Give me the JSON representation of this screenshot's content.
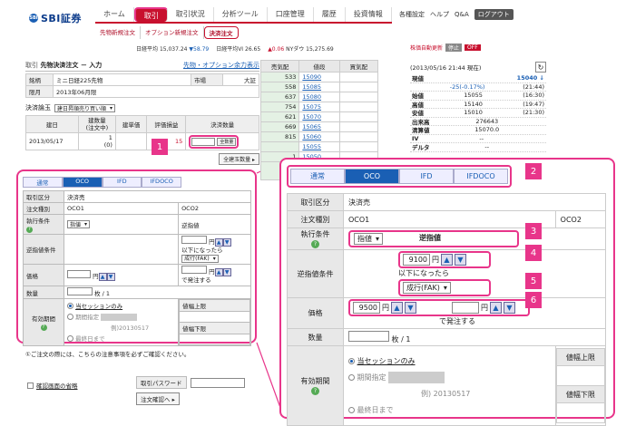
{
  "logo": {
    "mark": "SBI",
    "text": "SBI証券"
  },
  "nav": [
    "ホーム",
    "取引",
    "取引状況",
    "分析ツール",
    "口座管理",
    "履歴",
    "投資情報"
  ],
  "util": [
    "各種設定",
    "ヘルプ",
    "Q&A",
    "ログアウト"
  ],
  "subnav": [
    "先物新規注文",
    "オプション新規注文",
    "決済注文"
  ],
  "ticker": {
    "nikkei_label": "日経平均",
    "nikkei": "15,037.24",
    "nikkei_chg": "▼58.79",
    "nk_label": "日経平均VI",
    "nk": "26.65",
    "ny_chg": "▲0.06",
    "ny_label": "NYダウ",
    "ny": "15,275.69"
  },
  "auto": {
    "label": "株価自動更新",
    "btn": "停止",
    "state": "OFF"
  },
  "left": {
    "title": "先物決済注文 － 入力",
    "title_prefix": "取引",
    "margin_link": "先物・オプション余力表示",
    "product_label": "銘柄",
    "product": "ミニ日経225先物",
    "market_label": "市場",
    "market": "大証",
    "month_label": "限月",
    "month": "2013年06月限",
    "order_label": "決済論玉",
    "order_select": "建日昇順売り買い順",
    "headers": [
      "建日",
      "建数量\n(注文中)",
      "建単価",
      "評価損益",
      "決済数量"
    ],
    "row": {
      "date": "2013/05/17",
      "qty": "1",
      "pending": "(0)",
      "price": "15",
      "btn": "全数量"
    },
    "all_btn": "全建玉数量 ▸",
    "tabs": [
      "通常",
      "OCO",
      "IFD",
      "IFDOCO"
    ],
    "f_kind_label": "取引区分",
    "f_kind": "決済売",
    "f_type_label": "注文種別",
    "f_oco1": "OCO1",
    "f_oco2": "OCO2",
    "f_cond_label": "執行条件",
    "f_cond": "指値",
    "f_cond2": "逆指値",
    "f_stop_label": "逆指値条件",
    "f_stop_text": "以下になったら",
    "f_stop_sel": "成行(FAK)",
    "f_price_label": "価格",
    "f_yen": "円",
    "f_send": "で発注する",
    "f_qty_label": "数量",
    "f_qty_unit": "枚 / 1",
    "f_period_label": "有効期間",
    "f_p1": "当セッションのみ",
    "f_p2": "期間指定",
    "f_p3": "最終日まで",
    "f_date": "例)20130517",
    "f_up": "値幅上限",
    "f_down": "値幅下限",
    "notice": "①ご注文の際には、こちらの注意事項を必ずご確認ください。",
    "confirm": "確認画面の省略",
    "pass_label": "取引パスワード",
    "submit": "注文確認へ ▸"
  },
  "pos": {
    "headers": [
      "売気配",
      "値段",
      "買気配"
    ],
    "prices": [
      "15090",
      "15085",
      "15080",
      "15075",
      "15070",
      "15065",
      "15060",
      "15055",
      "15050"
    ],
    "sells": [
      "533",
      "558",
      "637",
      "754",
      "621",
      "669",
      "815",
      "",
      "1"
    ]
  },
  "quote": {
    "time": "(2013/05/16 21:44 現在)",
    "now_label": "現値",
    "now": "15040 ↓",
    "chg": "-25(-0.17%)",
    "chg_time": "(21:44)",
    "rows": [
      [
        "始値",
        "15055",
        "(16:30)"
      ],
      [
        "高値",
        "15140",
        "(19:47)"
      ],
      [
        "安値",
        "15010",
        "(21:30)"
      ],
      [
        "出来高",
        "276643",
        ""
      ],
      [
        "清算値",
        "15070.0",
        ""
      ],
      [
        "IV",
        "--",
        ""
      ],
      [
        "デルタ",
        "--",
        ""
      ]
    ]
  },
  "zoom": {
    "tabs": [
      "通常",
      "OCO",
      "IFD",
      "IFDOCO"
    ],
    "kind_label": "取引区分",
    "kind": "決済売",
    "type_label": "注文種別",
    "oco1": "OCO1",
    "oco2": "OCO2",
    "cond_label": "執行条件",
    "cond": "指値",
    "cond2": "逆指値",
    "stop_label": "逆指値条件",
    "stop_value": "9100",
    "yen": "円",
    "stop_text": "以下になったら",
    "stop_sel": "成行(FAK)",
    "price_label": "価格",
    "price_value": "9500",
    "send": "で発注する",
    "qty_label": "数量",
    "qty_unit": "枚 / 1",
    "period_label": "有効期間",
    "p1": "当セッションのみ",
    "p2": "期間指定",
    "p3": "最終日まで",
    "date": "例) 20130517",
    "up": "値幅上限",
    "down": "値幅下限"
  },
  "badges": [
    "1",
    "2",
    "3",
    "4",
    "5",
    "6"
  ],
  "colors": {
    "accent": "#e8358a",
    "brand": "#c8102e",
    "blue": "#1a5fb4"
  }
}
